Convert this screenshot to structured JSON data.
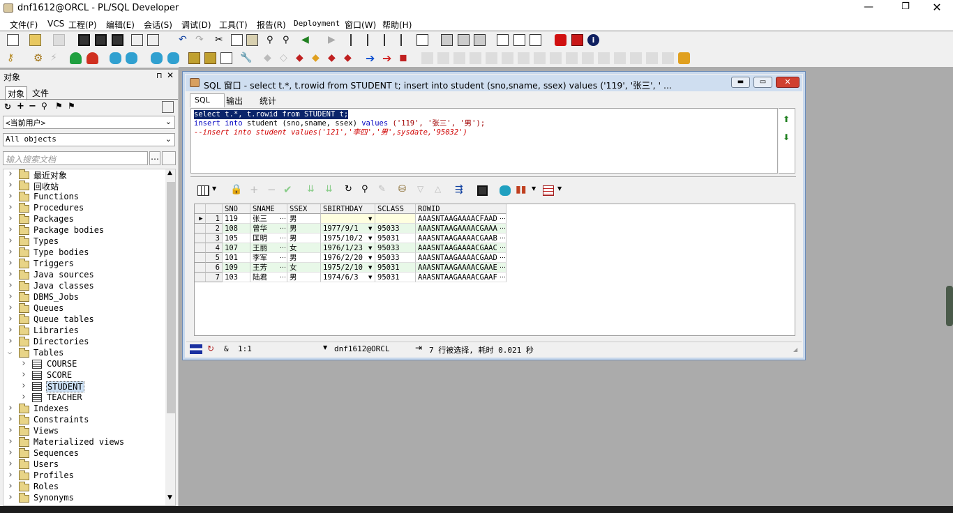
{
  "window": {
    "title": "dnf1612@ORCL - PL/SQL Developer"
  },
  "menu": [
    "文件(F)",
    "VCS",
    "工程(P)",
    "编辑(E)",
    "会话(S)",
    "调试(D)",
    "工具(T)",
    "报告(R)",
    "Deployment",
    "窗口(W)",
    "帮助(H)"
  ],
  "object_browser": {
    "panel_title": "对象",
    "tabs": [
      "对象",
      "文件"
    ],
    "user_select": "<当前用户>",
    "filter_select": "All objects",
    "search_placeholder": "输入搜索文档",
    "tree": [
      {
        "label": "最近对象",
        "level": 0
      },
      {
        "label": "回收站",
        "level": 0
      },
      {
        "label": "Functions",
        "level": 0
      },
      {
        "label": "Procedures",
        "level": 0
      },
      {
        "label": "Packages",
        "level": 0
      },
      {
        "label": "Package bodies",
        "level": 0
      },
      {
        "label": "Types",
        "level": 0
      },
      {
        "label": "Type bodies",
        "level": 0
      },
      {
        "label": "Triggers",
        "level": 0
      },
      {
        "label": "Java sources",
        "level": 0
      },
      {
        "label": "Java classes",
        "level": 0
      },
      {
        "label": "DBMS_Jobs",
        "level": 0
      },
      {
        "label": "Queues",
        "level": 0
      },
      {
        "label": "Queue tables",
        "level": 0
      },
      {
        "label": "Libraries",
        "level": 0
      },
      {
        "label": "Directories",
        "level": 0
      },
      {
        "label": "Tables",
        "level": 0,
        "expanded": true
      },
      {
        "label": "COURSE",
        "level": 1
      },
      {
        "label": "SCORE",
        "level": 1
      },
      {
        "label": "STUDENT",
        "level": 1,
        "selected": true
      },
      {
        "label": "TEACHER",
        "level": 1
      },
      {
        "label": "Indexes",
        "level": 0
      },
      {
        "label": "Constraints",
        "level": 0
      },
      {
        "label": "Views",
        "level": 0
      },
      {
        "label": "Materialized views",
        "level": 0
      },
      {
        "label": "Sequences",
        "level": 0
      },
      {
        "label": "Users",
        "level": 0
      },
      {
        "label": "Profiles",
        "level": 0
      },
      {
        "label": "Roles",
        "level": 0
      },
      {
        "label": "Synonyms",
        "level": 0
      }
    ]
  },
  "sql_window": {
    "title": "SQL 窗口 - select t.*, t.rowid from STUDENT t; insert into student (sno,sname, ssex) values ('119', '张三', ' ...",
    "tabs": [
      "SQL",
      "输出",
      "统计"
    ],
    "code": {
      "line1": "select t.*, t.rowid from STUDENT t;",
      "line2_kw1": "insert into",
      "line2_mid": " student (sno,sname, ssex) ",
      "line2_kw2": "values",
      "line2_vals": " ('119', '张三', '男');",
      "line3": "--insert into student values('121','李四','男',sysdate,'95032')"
    },
    "grid": {
      "columns": [
        "SNO",
        "SNAME",
        "SSEX",
        "SBIRTHDAY",
        "SCLASS",
        "ROWID"
      ],
      "rows": [
        [
          "1",
          "119",
          "张三",
          "男",
          "",
          "",
          "AAASNTAAGAAAACFAAD"
        ],
        [
          "2",
          "108",
          "曾华",
          "男",
          "1977/9/1",
          "95033",
          "AAASNTAAGAAAACGAAA"
        ],
        [
          "3",
          "105",
          "匡明",
          "男",
          "1975/10/2",
          "95031",
          "AAASNTAAGAAAACGAAB"
        ],
        [
          "4",
          "107",
          "王丽",
          "女",
          "1976/1/23",
          "95033",
          "AAASNTAAGAAAACGAAC"
        ],
        [
          "5",
          "101",
          "李军",
          "男",
          "1976/2/20",
          "95033",
          "AAASNTAAGAAAACGAAD"
        ],
        [
          "6",
          "109",
          "王芳",
          "女",
          "1975/2/10",
          "95031",
          "AAASNTAAGAAAACGAAE"
        ],
        [
          "7",
          "103",
          "陆君",
          "男",
          "1974/6/3",
          "95031",
          "AAASNTAAGAAAACGAAF"
        ]
      ]
    },
    "status": {
      "amp": "&",
      "pos": "1:1",
      "conn": "dnf1612@ORCL",
      "msg": "7 行被选择, 耗时 0.021 秒"
    }
  },
  "colors": {
    "selection": "#0a246a",
    "keyword": "#0000c0",
    "string": "#a00000",
    "comment": "#d00000",
    "row_alt": "#e8f8e8"
  }
}
